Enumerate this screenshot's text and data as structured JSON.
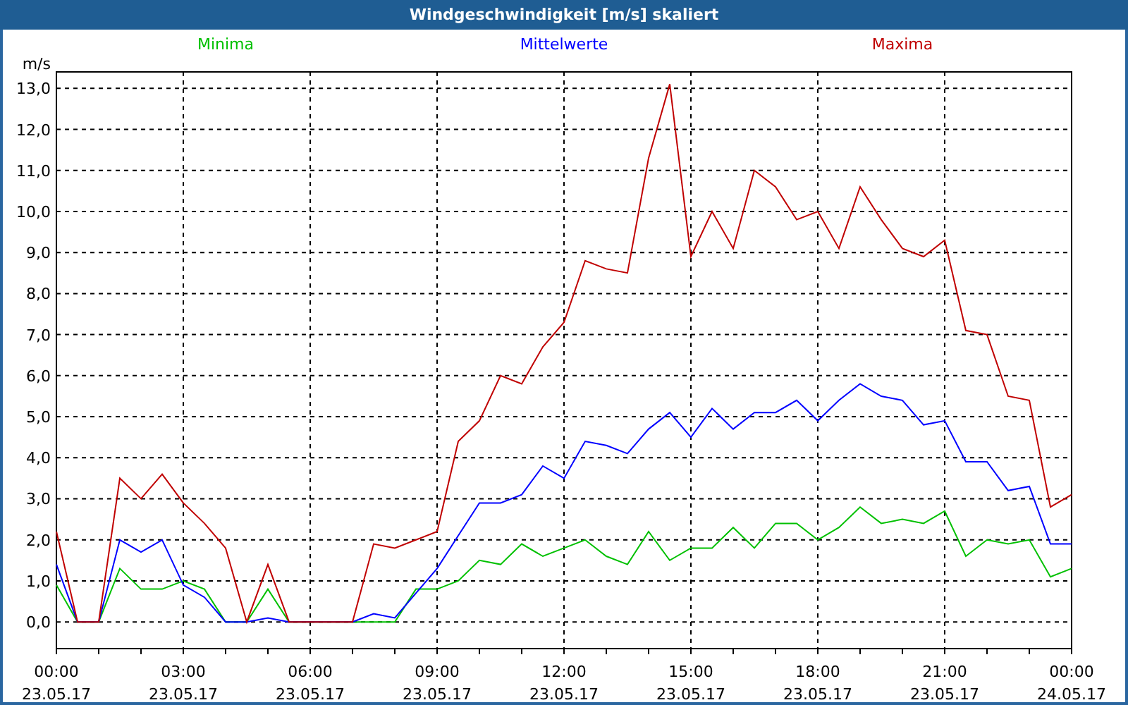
{
  "window": {
    "title": "Windgeschwindigkeit [m/s] skaliert"
  },
  "chart": {
    "chart_data": {
      "type": "line",
      "ylabel": "m/s",
      "categories": [
        "00:00\n23.05.17",
        null,
        null,
        null,
        null,
        null,
        "03:00\n23.05.17",
        null,
        null,
        null,
        null,
        null,
        "06:00\n23.05.17",
        null,
        null,
        null,
        null,
        null,
        "09:00\n23.05.17",
        null,
        null,
        null,
        null,
        null,
        "12:00\n23.05.17",
        null,
        null,
        null,
        null,
        null,
        "15:00\n23.05.17",
        null,
        null,
        null,
        null,
        null,
        "18:00\n23.05.17",
        null,
        null,
        null,
        null,
        null,
        "21:00\n23.05.17",
        null,
        null,
        null,
        null,
        null,
        "00:00\n24.05.17"
      ],
      "series": [
        {
          "name": "Minima",
          "color": "#00c000",
          "values": [
            0.9,
            0,
            0,
            1.3,
            0.8,
            0.8,
            1.0,
            0.8,
            0,
            0,
            0.8,
            0,
            0,
            0,
            0,
            0,
            0,
            0.8,
            0.8,
            1.0,
            1.5,
            1.4,
            1.9,
            1.6,
            1.8,
            2.0,
            1.6,
            1.4,
            2.2,
            1.5,
            1.8,
            1.8,
            2.3,
            1.8,
            2.4,
            2.4,
            2.0,
            2.3,
            2.8,
            2.4,
            2.5,
            2.4,
            2.7,
            1.6,
            2.0,
            1.9,
            2.0,
            1.1,
            1.3
          ]
        },
        {
          "name": "Mittelwerte",
          "color": "#0000ff",
          "values": [
            1.4,
            0,
            0,
            2.0,
            1.7,
            2.0,
            0.9,
            0.6,
            0,
            0,
            0.1,
            0,
            0,
            0,
            0,
            0.2,
            0.1,
            0.7,
            1.3,
            2.1,
            2.9,
            2.9,
            3.1,
            3.8,
            3.5,
            4.4,
            4.3,
            4.1,
            4.7,
            5.1,
            4.5,
            5.2,
            4.7,
            5.1,
            5.1,
            5.4,
            4.9,
            5.4,
            5.8,
            5.5,
            5.4,
            4.8,
            4.9,
            3.9,
            3.9,
            3.2,
            3.3,
            1.9,
            1.9
          ]
        },
        {
          "name": "Maxima",
          "color": "#c00000",
          "values": [
            2.2,
            0,
            0,
            3.5,
            3.0,
            3.6,
            2.9,
            2.4,
            1.8,
            0,
            1.4,
            0,
            0,
            0,
            0,
            1.9,
            1.8,
            2.0,
            2.2,
            4.4,
            4.9,
            6.0,
            5.8,
            6.7,
            7.3,
            8.8,
            8.6,
            8.5,
            11.3,
            13.1,
            8.9,
            10.0,
            9.1,
            11.0,
            10.6,
            9.8,
            10.0,
            9.1,
            10.6,
            9.8,
            9.1,
            8.9,
            9.3,
            7.1,
            7.0,
            5.5,
            5.4,
            2.8,
            3.1
          ]
        }
      ],
      "grid": true,
      "ylim": [
        -0.65,
        13.4
      ],
      "yticks": [
        {
          "value": 0,
          "label": "0,0"
        },
        {
          "value": 1,
          "label": "1,0"
        },
        {
          "value": 2,
          "label": "2,0"
        },
        {
          "value": 3,
          "label": "3,0"
        },
        {
          "value": 4,
          "label": "4,0"
        },
        {
          "value": 5,
          "label": "5,0"
        },
        {
          "value": 6,
          "label": "6,0"
        },
        {
          "value": 7,
          "label": "7,0"
        },
        {
          "value": 8,
          "label": "8,0"
        },
        {
          "value": 9,
          "label": "9,0"
        },
        {
          "value": 10,
          "label": "10,0"
        },
        {
          "value": 11,
          "label": "11,0"
        },
        {
          "value": 12,
          "label": "12,0"
        },
        {
          "value": 13,
          "label": "13,0"
        }
      ]
    }
  }
}
